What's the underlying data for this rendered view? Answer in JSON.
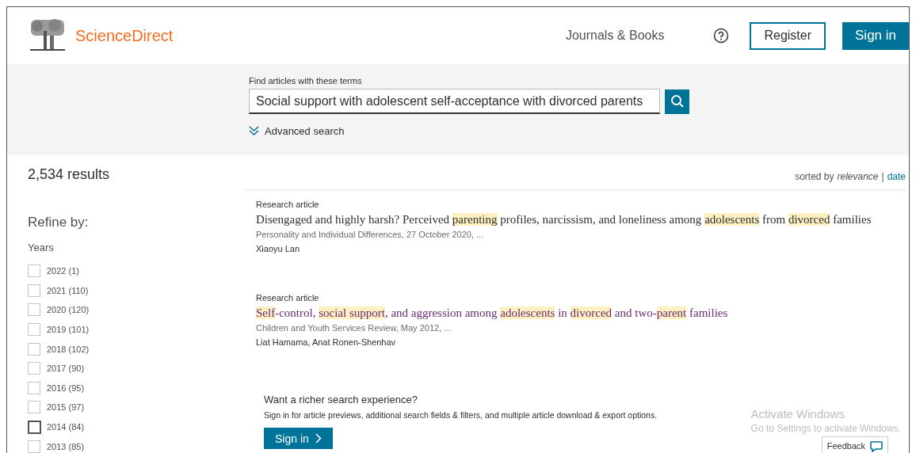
{
  "header": {
    "logo_text": "ScienceDirect",
    "nav_link": "Journals & Books",
    "register_button": "Register",
    "signin_button": "Sign in"
  },
  "search": {
    "label": "Find articles with these terms",
    "value": "Social support with adolescent self-acceptance with divorced parents",
    "advanced_link": "Advanced search"
  },
  "results_count": "2,534 results",
  "sort": {
    "prefix": "sorted by",
    "separator": "|",
    "options": [
      {
        "label": "relevance",
        "selected": true
      },
      {
        "label": "date",
        "selected": false
      }
    ]
  },
  "refine": {
    "title": "Refine by:",
    "group": "Years",
    "years": [
      {
        "label": "2022 (1)",
        "checked": false,
        "hovered": false
      },
      {
        "label": "2021 (110)",
        "checked": false,
        "hovered": false
      },
      {
        "label": "2020 (120)",
        "checked": false,
        "hovered": false
      },
      {
        "label": "2019 (101)",
        "checked": false,
        "hovered": false
      },
      {
        "label": "2018 (102)",
        "checked": false,
        "hovered": false
      },
      {
        "label": "2017 (90)",
        "checked": false,
        "hovered": false
      },
      {
        "label": "2016 (95)",
        "checked": false,
        "hovered": false
      },
      {
        "label": "2015 (97)",
        "checked": false,
        "hovered": false
      },
      {
        "label": "2014 (84)",
        "checked": false,
        "hovered": true
      },
      {
        "label": "2013 (85)",
        "checked": false,
        "hovered": false
      }
    ]
  },
  "articles": [
    {
      "type": "Research article",
      "visited": false,
      "title": [
        {
          "text": "Disengaged and highly harsh? Perceived ",
          "highlight": false
        },
        {
          "text": "parenting",
          "highlight": true
        },
        {
          "text": " profiles, narcissism, and loneliness among ",
          "highlight": false
        },
        {
          "text": "adolescents",
          "highlight": true
        },
        {
          "text": " from ",
          "highlight": false
        },
        {
          "text": "divorced",
          "highlight": true
        },
        {
          "text": " families",
          "highlight": false
        }
      ],
      "source": "Personality and Individual Differences, 27 October 2020, ...",
      "authors": "Xiaoyu Lan"
    },
    {
      "type": "Research article",
      "visited": true,
      "title": [
        {
          "text": "Self",
          "highlight": true
        },
        {
          "text": "-control, ",
          "highlight": false
        },
        {
          "text": "social support",
          "highlight": true
        },
        {
          "text": ", and aggression among ",
          "highlight": false
        },
        {
          "text": "adolescents",
          "highlight": true
        },
        {
          "text": " in ",
          "highlight": false
        },
        {
          "text": "divorced",
          "highlight": true
        },
        {
          "text": " and two-",
          "highlight": false
        },
        {
          "text": "parent",
          "highlight": true
        },
        {
          "text": " families",
          "highlight": false
        }
      ],
      "source": "Children and Youth Services Review, May 2012, ...",
      "authors": "Liat Hamama, Anat Ronen-Shenhav"
    }
  ],
  "promo": {
    "heading": "Want a richer search experience?",
    "text": "Sign in for article previews, additional search fields & filters, and multiple article download & export options.",
    "button": "Sign in"
  },
  "feedback": "Feedback",
  "os_notice": {
    "title": "Activate Windows",
    "subtitle": "Go to Settings to activate Windows."
  }
}
